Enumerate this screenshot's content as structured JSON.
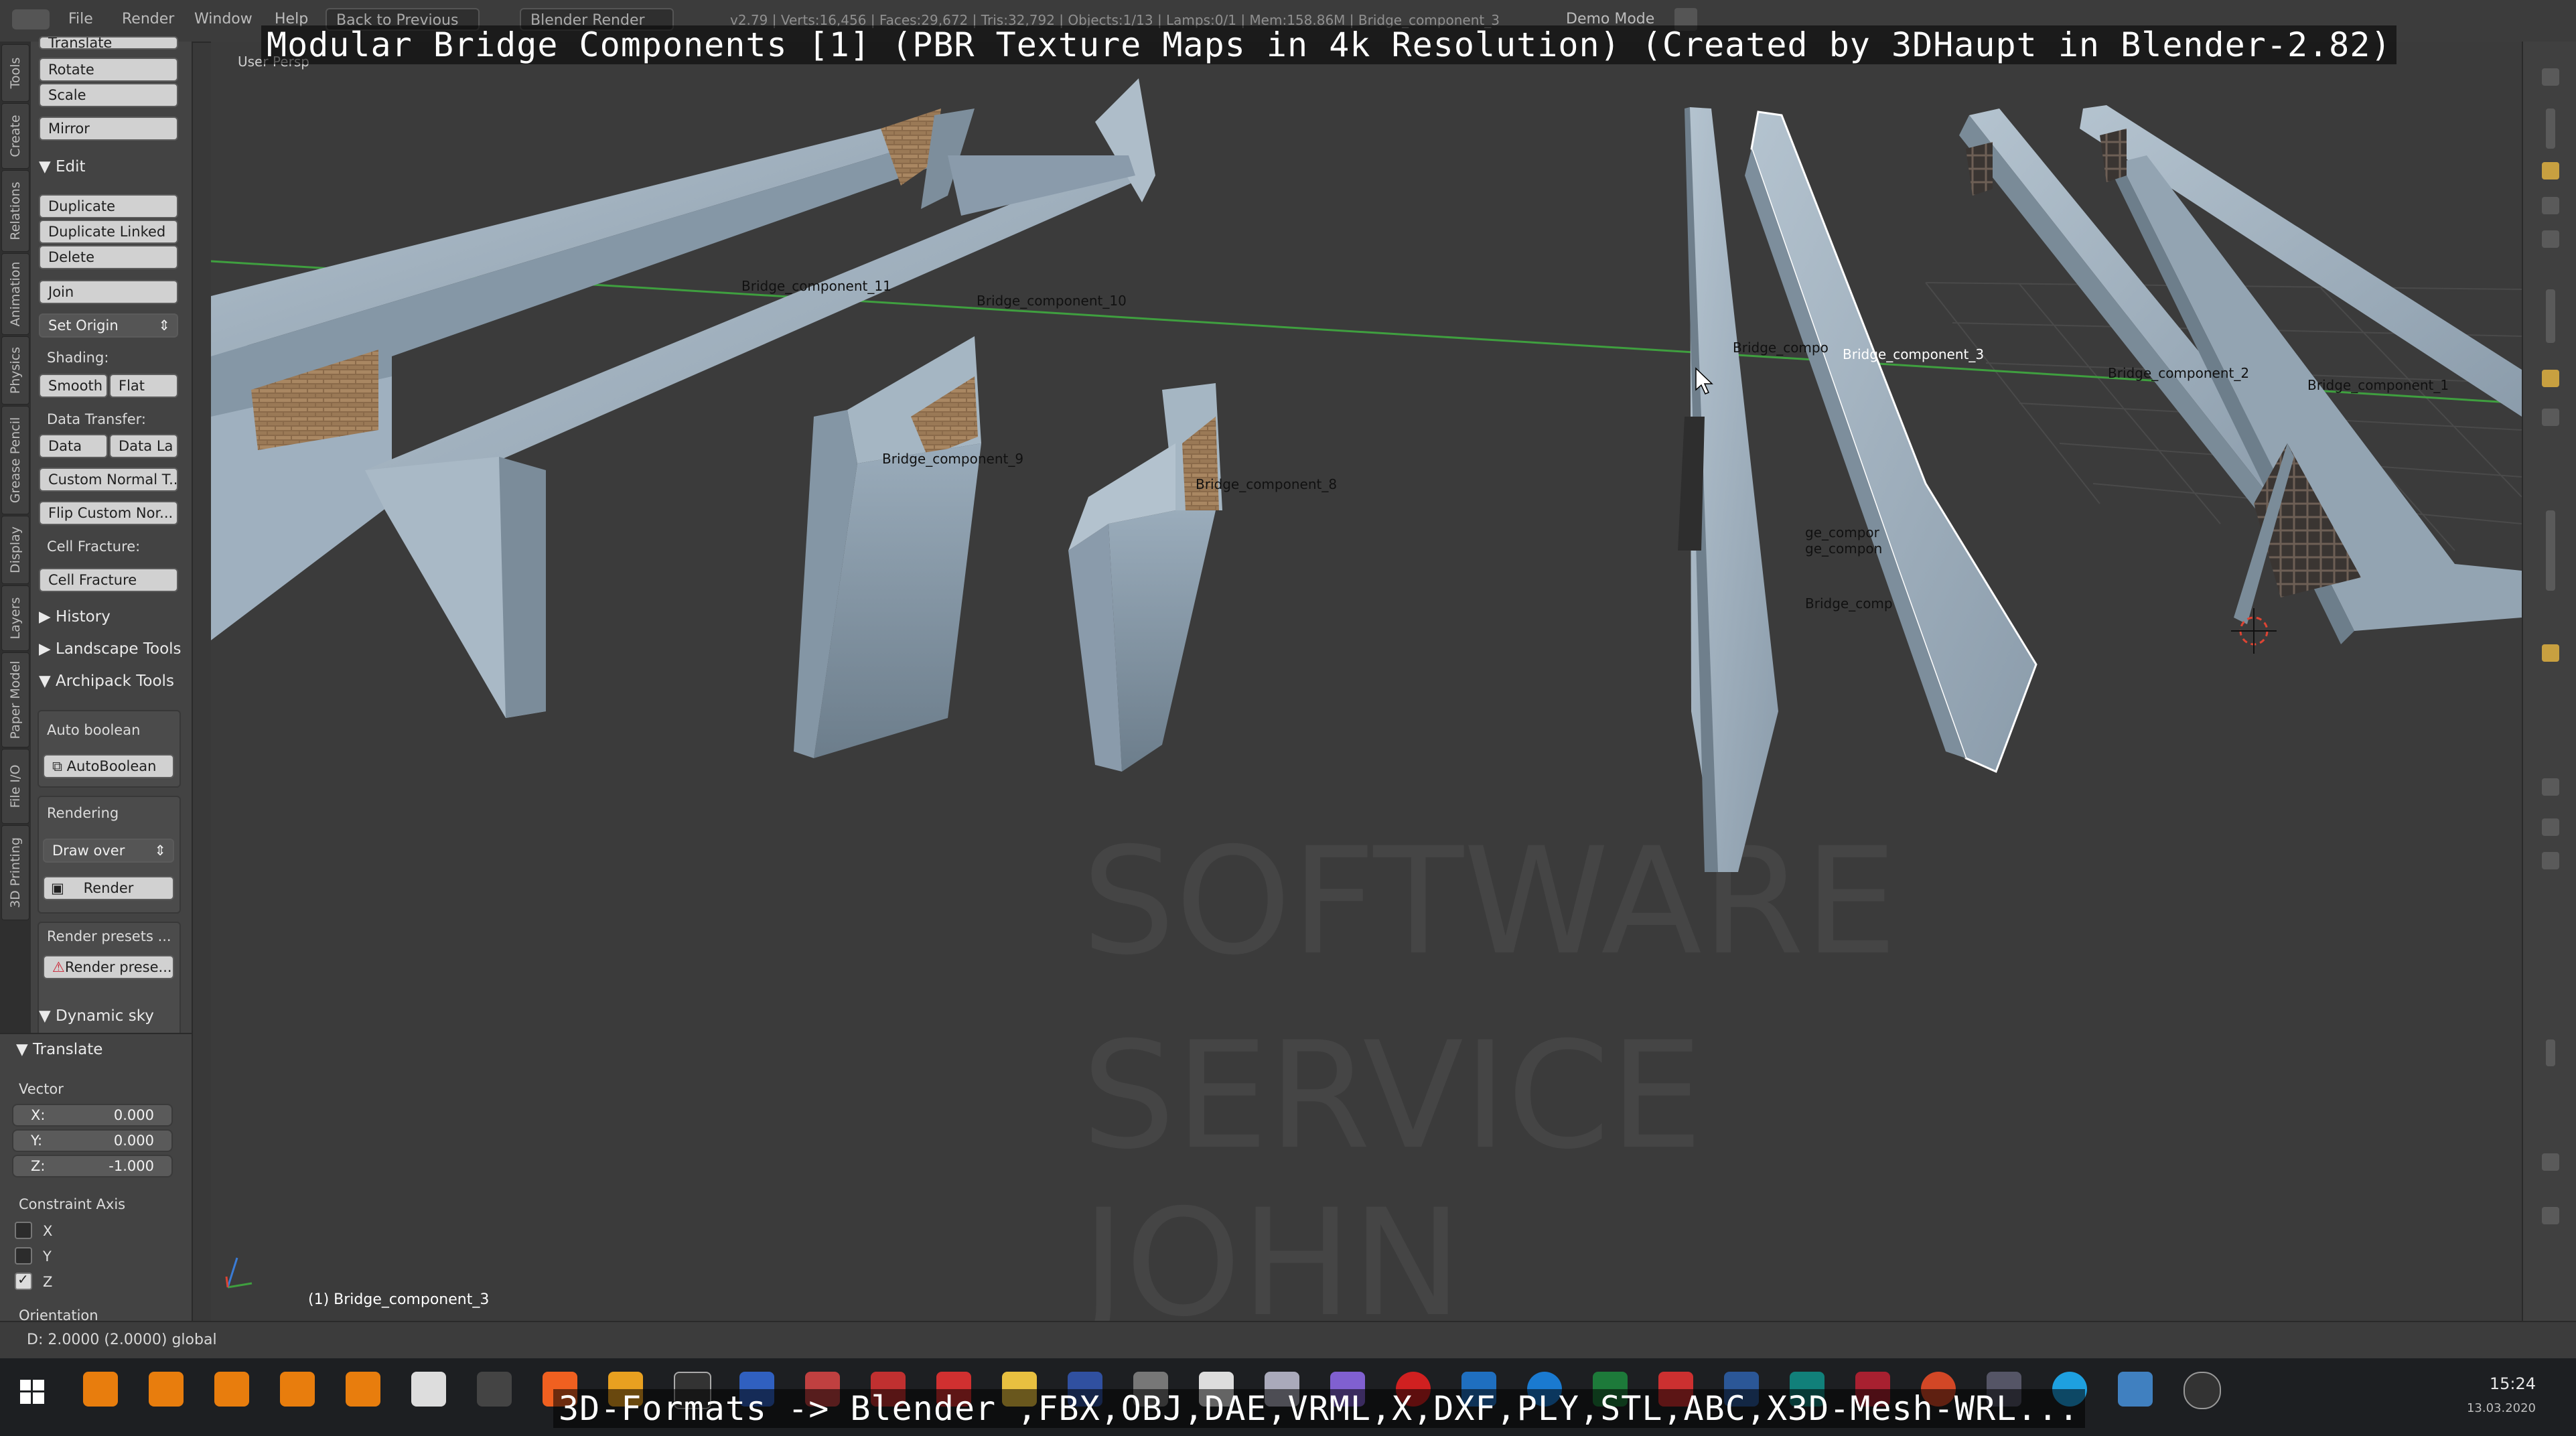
{
  "overlay": {
    "title": "Modular Bridge Components [1] (PBR Texture Maps in 4k Resolution) (Created by 3DHaupt in Blender-2.82)",
    "footer": "3D-Formats -> Blender ,FBX,OBJ,DAE,VRML,X,DXF,PLY,STL,ABC,X3D-Mesh-WRL..."
  },
  "menubar": {
    "file": "File",
    "render": "Render",
    "window": "Window",
    "help": "Help",
    "back": "Back to Previous",
    "engine": "Blender Render",
    "stats": "v2.79 | Verts:16,456 | Faces:29,672 | Tris:32,792 | Objects:1/13 | Lamps:0/1 | Mem:158.86M | Bridge_component_3",
    "mode": "Demo Mode"
  },
  "tabs": [
    "Tools",
    "Create",
    "Relations",
    "Animation",
    "Physics",
    "Grease Pencil",
    "Display",
    "Layers",
    "Paper Model",
    "File I/O",
    "3D Printing"
  ],
  "toolshelf": {
    "translate_partial": "Translate",
    "rotate": "Rotate",
    "scale": "Scale",
    "mirror": "Mirror",
    "edit_header": "Edit",
    "duplicate": "Duplicate",
    "duplicate_linked": "Duplicate Linked",
    "delete": "Delete",
    "join": "Join",
    "set_origin": "Set Origin",
    "shading_label": "Shading:",
    "smooth": "Smooth",
    "flat": "Flat",
    "data_transfer_label": "Data Transfer:",
    "data": "Data",
    "data_la": "Data La",
    "custom_normal": "Custom Normal T...",
    "flip_custom": "Flip Custom Nor...",
    "cell_fracture_label": "Cell Fracture:",
    "cell_fracture": "Cell Fracture",
    "history": "History",
    "landscape_tools": "Landscape Tools",
    "archipack_tools": "Archipack Tools",
    "auto_boolean_label": "Auto boolean",
    "auto_boolean_btn": "AutoBoolean",
    "rendering_label": "Rendering",
    "draw_over": "Draw over",
    "render_btn": "Render",
    "render_presets_label": "Render presets ...",
    "render_presets_btn": "Render prese...",
    "dynamic_sky": "Dynamic sky"
  },
  "operator": {
    "header": "Translate",
    "vector_label": "Vector",
    "x_key": "X:",
    "x_val": "0.000",
    "y_key": "Y:",
    "y_val": "0.000",
    "z_key": "Z:",
    "z_val": "-1.000",
    "constraint_label": "Constraint Axis",
    "cx": "X",
    "cy": "Y",
    "cz": "Z",
    "orientation": "Orientation"
  },
  "viewport": {
    "view_label": "User Persp",
    "object_label": "(1) Bridge_component_3",
    "objects": [
      "Bridge_component_11",
      "Bridge_component_10",
      "Bridge_component_9",
      "Bridge_component_8",
      "Bridge_compo",
      "Bridge_component_3",
      "Bridge_component_2",
      "Bridge_component_1",
      "ge_compor",
      "ge_compon",
      "Bridge_comp"
    ],
    "watermark": [
      "SOFTWARE",
      "SERVICE",
      "JOHN"
    ]
  },
  "status": "D: 2.0000 (2.0000) global",
  "clock": {
    "time": "15:24",
    "date": "13.03.2020"
  },
  "colors": {
    "concrete": "#9fb0bf",
    "concrete_dark": "#6f7f8c",
    "grid_line": "#3f9f3f",
    "brick": "#8a6a4a",
    "button": "#d1d1d1"
  }
}
